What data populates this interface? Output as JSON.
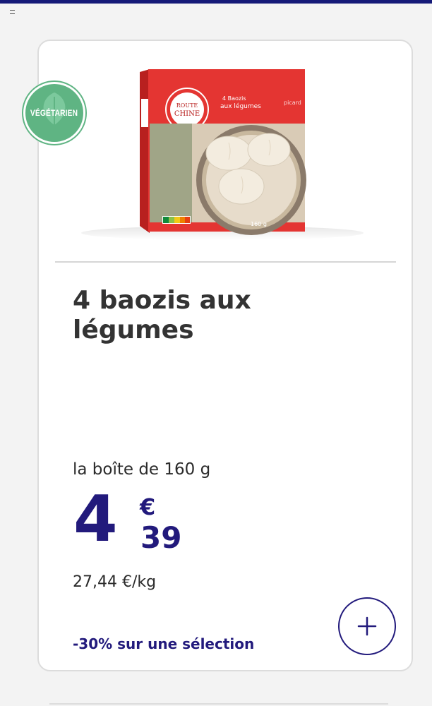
{
  "badge": {
    "label": "VÉGÉTARIEN",
    "color": "#5fb483"
  },
  "product": {
    "title": "4 baozis aux légumes",
    "image": {
      "package_line1": "4 Baozis",
      "package_line2": "aux légumes",
      "brand_text": "CHINE",
      "picard_text": "picard",
      "weight_text": "160 g",
      "nutriscore": "ABCDE"
    },
    "unit": "la boîte de 160 g",
    "price": {
      "integer": "4",
      "currency": "€",
      "cents": "39"
    },
    "price_per_kg": "27,44 €/kg",
    "promo": "-30% sur une sélection"
  },
  "colors": {
    "accent": "#221a7c",
    "package_red": "#e43532",
    "top_bar": "#151a78"
  },
  "add_button": {
    "icon": "plus-icon"
  }
}
